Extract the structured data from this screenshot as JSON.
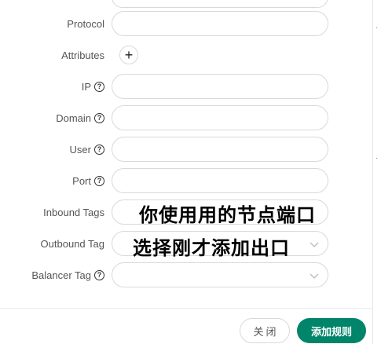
{
  "form": {
    "fields": {
      "protocol": {
        "label": "Protocol",
        "value": ""
      },
      "attributes": {
        "label": "Attributes",
        "add_icon": "+"
      },
      "ip": {
        "label": "IP",
        "value": ""
      },
      "domain": {
        "label": "Domain",
        "value": ""
      },
      "user": {
        "label": "User",
        "value": ""
      },
      "port": {
        "label": "Port",
        "value": ""
      },
      "inbound_tags": {
        "label": "Inbound Tags",
        "value": ""
      },
      "outbound_tag": {
        "label": "Outbound Tag",
        "value": ""
      },
      "balancer_tag": {
        "label": "Balancer Tag",
        "value": ""
      }
    },
    "help_icon": "?"
  },
  "annotations": {
    "inbound_note": "你使用用的节点端口",
    "outbound_note": "选择刚才添加出口"
  },
  "footer": {
    "close_label": "关闭",
    "add_rule_label": "添加规则"
  },
  "icons": {
    "help": "question-circle-icon",
    "add": "plus-icon",
    "select_arrow": "chevron-down-icon"
  },
  "colors": {
    "primary": "#00856a",
    "border": "#d9d9d9"
  }
}
